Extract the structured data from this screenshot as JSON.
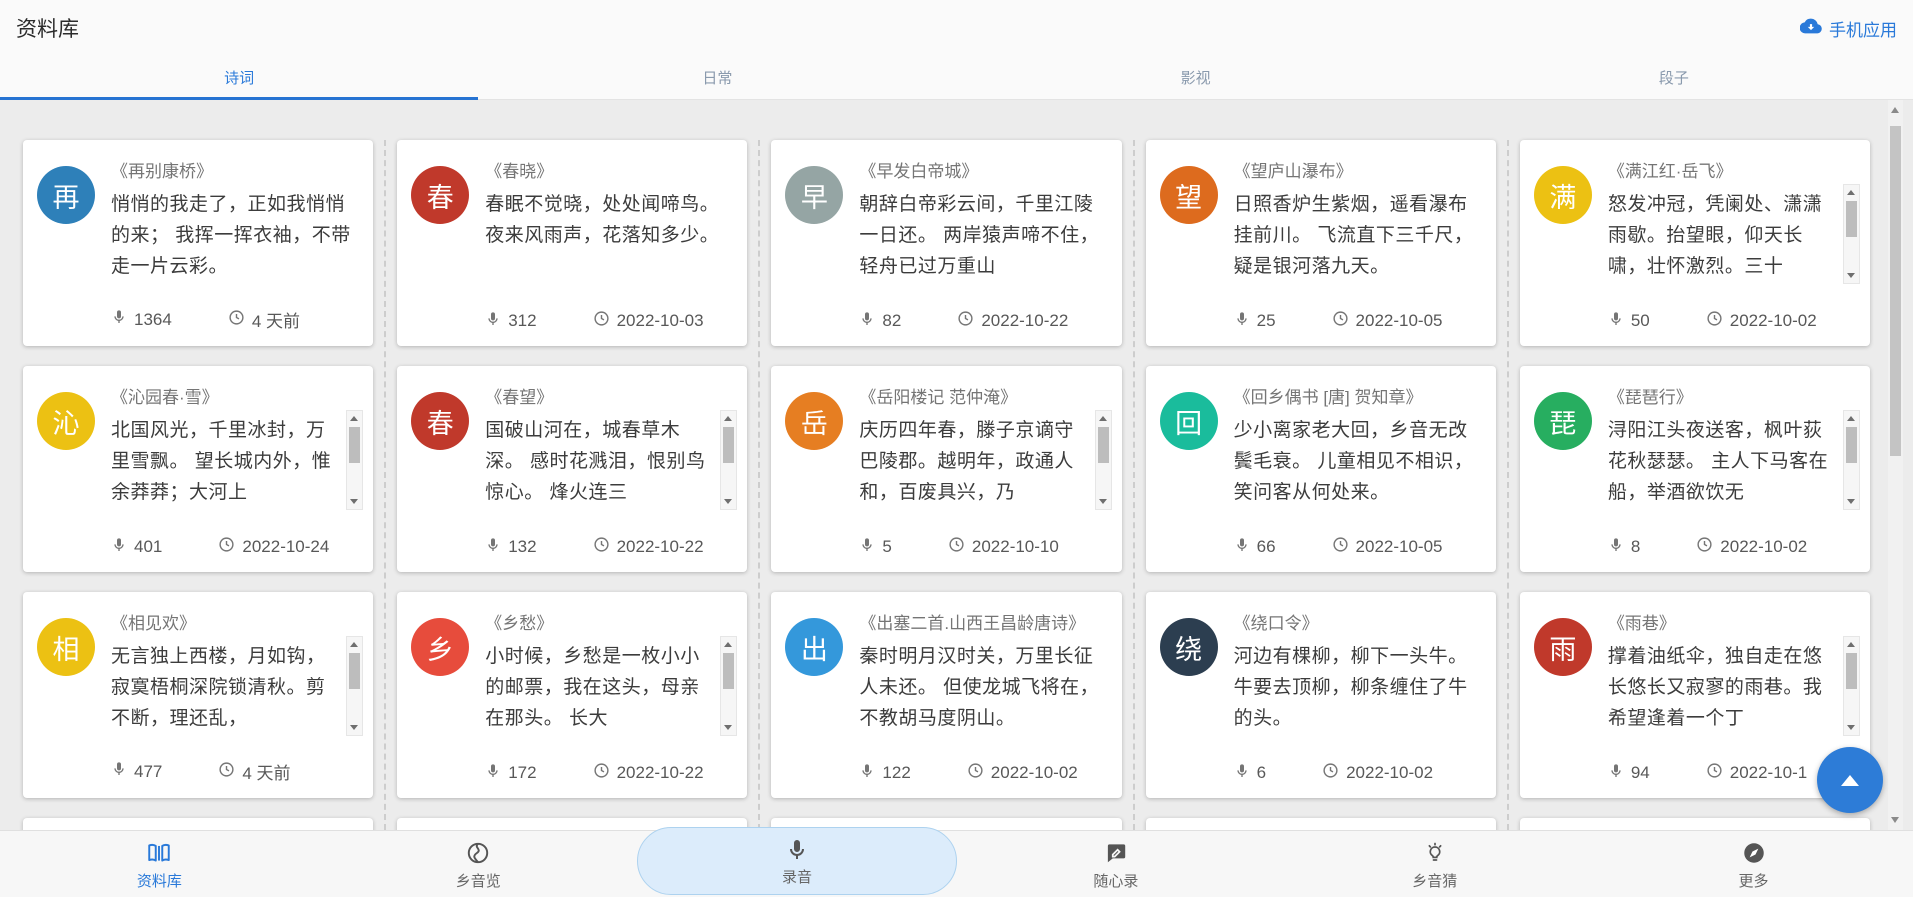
{
  "header": {
    "title": "资料库",
    "mobile_app_label": "手机应用",
    "mobile_app_icon": "cloud-download-icon"
  },
  "colors": {
    "accent": "#2979d9",
    "record_pill_bg": "#dcecfb",
    "content_bg": "#ececec"
  },
  "tabs": {
    "items": [
      {
        "label": "诗词",
        "active": true
      },
      {
        "label": "日常",
        "active": false
      },
      {
        "label": "影视",
        "active": false
      },
      {
        "label": "段子",
        "active": false
      }
    ]
  },
  "card_meta_icons": {
    "count_icon": "microphone-icon",
    "date_icon": "clock-icon"
  },
  "cards": [
    {
      "initial": "再",
      "color": "#2e80b9",
      "title": "《再别康桥》",
      "text": "悄悄的我走了，正如我悄悄的来； 我挥一挥衣袖，不带走一片云彩。",
      "count": "1364",
      "date": "4 天前",
      "scrollable": false
    },
    {
      "initial": "春",
      "color": "#c0392b",
      "title": "《春晓》",
      "text": "春眠不觉晓，处处闻啼鸟。夜来风雨声，花落知多少。",
      "count": "312",
      "date": "2022-10-03",
      "scrollable": false
    },
    {
      "initial": "早",
      "color": "#95a5a4",
      "title": "《早发白帝城》",
      "text": "朝辞白帝彩云间，千里江陵一日还。 两岸猿声啼不住，轻舟已过万重山",
      "count": "82",
      "date": "2022-10-22",
      "scrollable": false
    },
    {
      "initial": "望",
      "color": "#dd6b1e",
      "title": "《望庐山瀑布》",
      "text": "日照香炉生紫烟，遥看瀑布挂前川。 飞流直下三千尺，疑是银河落九天。",
      "count": "25",
      "date": "2022-10-05",
      "scrollable": false
    },
    {
      "initial": "满",
      "color": "#ecc113",
      "title": "《满江红·岳飞》",
      "text": "怒发冲冠，凭阑处、潇潇雨歇。抬望眼，仰天长啸，壮怀激烈。三十",
      "count": "50",
      "date": "2022-10-02",
      "scrollable": true
    },
    {
      "initial": "沁",
      "color": "#ecc113",
      "title": "《沁园春·雪》",
      "text": "北国风光，千里冰封，万里雪飘。 望长城内外，惟余莽莽；大河上",
      "count": "401",
      "date": "2022-10-24",
      "scrollable": true
    },
    {
      "initial": "春",
      "color": "#c0392b",
      "title": "《春望》",
      "text": "国破山河在，城春草木深。 感时花溅泪，恨别鸟惊心。 烽火连三",
      "count": "132",
      "date": "2022-10-22",
      "scrollable": true
    },
    {
      "initial": "岳",
      "color": "#e67e22",
      "title": "《岳阳楼记 范仲淹》",
      "text": "庆历四年春，滕子京谪守巴陵郡。越明年，政通人和，百废具兴，乃",
      "count": "5",
      "date": "2022-10-10",
      "scrollable": true
    },
    {
      "initial": "回",
      "color": "#1abc9c",
      "title": "《回乡偶书 [唐] 贺知章》",
      "text": "少小离家老大回，乡音无改鬓毛衰。 儿童相见不相识，笑问客从何处来。",
      "count": "66",
      "date": "2022-10-05",
      "scrollable": false
    },
    {
      "initial": "琵",
      "color": "#27ae60",
      "title": "《琵琶行》",
      "text": "浔阳江头夜送客，枫叶荻花秋瑟瑟。 主人下马客在船，举酒欲饮无",
      "count": "8",
      "date": "2022-10-02",
      "scrollable": true
    },
    {
      "initial": "相",
      "color": "#ecc113",
      "title": "《相见欢》",
      "text": "无言独上西楼，月如钩，寂寞梧桐深院锁清秋。剪不断，理还乱，",
      "count": "477",
      "date": "4 天前",
      "scrollable": true
    },
    {
      "initial": "乡",
      "color": "#e74c3c",
      "title": "《乡愁》",
      "text": "小时候，乡愁是一枚小小的邮票，我在这头，母亲在那头。 长大",
      "count": "172",
      "date": "2022-10-22",
      "scrollable": true
    },
    {
      "initial": "出",
      "color": "#3498db",
      "title": "《出塞二首.山西王昌龄唐诗》",
      "text": "秦时明月汉时关，万里长征人未还。 但使龙城飞将在，不教胡马度阴山。",
      "count": "122",
      "date": "2022-10-02",
      "scrollable": false
    },
    {
      "initial": "绕",
      "color": "#2c3e50",
      "title": "《绕口令》",
      "text": "河边有棵柳，柳下一头牛。 牛要去顶柳，柳条缠住了牛的头。",
      "count": "6",
      "date": "2022-10-02",
      "scrollable": false
    },
    {
      "initial": "雨",
      "color": "#c0392b",
      "title": "《雨巷》",
      "text": "撑着油纸伞，独自走在悠长悠长又寂寥的雨巷。我希望逢着一个丁",
      "count": "94",
      "date": "2022-10-1",
      "scrollable": true
    }
  ],
  "fab": {
    "icon": "arrow-up-icon"
  },
  "nav": {
    "items": [
      {
        "label": "资料库",
        "icon": "open-book-icon",
        "active": true
      },
      {
        "label": "乡音览",
        "icon": "globe-icon",
        "active": false
      },
      {
        "label": "录音",
        "icon": "microphone-icon",
        "active": false,
        "highlighted": true
      },
      {
        "label": "随心录",
        "icon": "note-bubble-icon",
        "active": false
      },
      {
        "label": "乡音猜",
        "icon": "lightbulb-icon",
        "active": false
      },
      {
        "label": "更多",
        "icon": "compass-icon",
        "active": false
      }
    ]
  }
}
